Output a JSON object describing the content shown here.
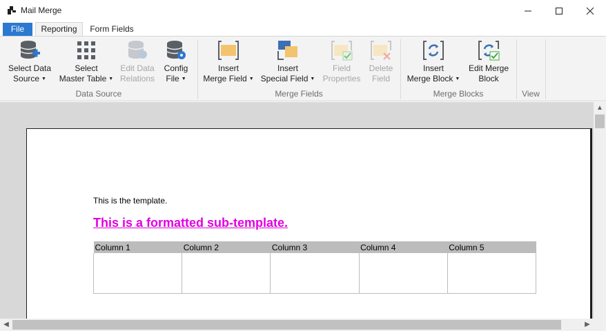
{
  "window": {
    "title": "Mail Merge"
  },
  "tabs": [
    {
      "label": "File"
    },
    {
      "label": "Reporting"
    },
    {
      "label": "Form Fields"
    }
  ],
  "ribbon": {
    "buttons": {
      "select_data_source": {
        "line1": "Select Data",
        "line2": "Source",
        "icon": "database-add-icon"
      },
      "select_master_table": {
        "line1": "Select",
        "line2": "Master Table",
        "icon": "table-grid-icon"
      },
      "edit_data_relations": {
        "line1": "Edit Data",
        "line2": "Relations",
        "icon": "database-relations-icon",
        "disabled": true
      },
      "config_file": {
        "line1": "Config",
        "line2": "File",
        "icon": "database-config-icon"
      },
      "insert_merge_field": {
        "line1": "Insert",
        "line2": "Merge Field",
        "icon": "merge-field-icon"
      },
      "insert_special_field": {
        "line1": "Insert",
        "line2": "Special Field",
        "icon": "special-field-icon"
      },
      "field_properties": {
        "line1": "Field",
        "line2": "Properties",
        "icon": "field-properties-icon",
        "disabled": true
      },
      "delete_field": {
        "line1": "Delete",
        "line2": "Field",
        "icon": "delete-field-icon",
        "disabled": true
      },
      "insert_merge_block": {
        "line1": "Insert",
        "line2": "Merge Block",
        "icon": "merge-block-icon"
      },
      "edit_merge_block": {
        "line1": "Edit Merge",
        "line2": "Block",
        "icon": "edit-merge-block-icon"
      }
    },
    "groups": {
      "data_source": "Data Source",
      "merge_fields": "Merge Fields",
      "merge_blocks": "Merge Blocks",
      "view": "View"
    }
  },
  "document": {
    "line1": "This is the template.",
    "subtemplate": "This is a formatted sub-template.",
    "table_headers": [
      "Column 1",
      "Column 2",
      "Column 3",
      "Column 4",
      "Column 5"
    ]
  },
  "colors": {
    "accent": "#2b79d0",
    "subtemplate_text": "#e000e0",
    "table_header_bg": "#bcbcbc"
  }
}
